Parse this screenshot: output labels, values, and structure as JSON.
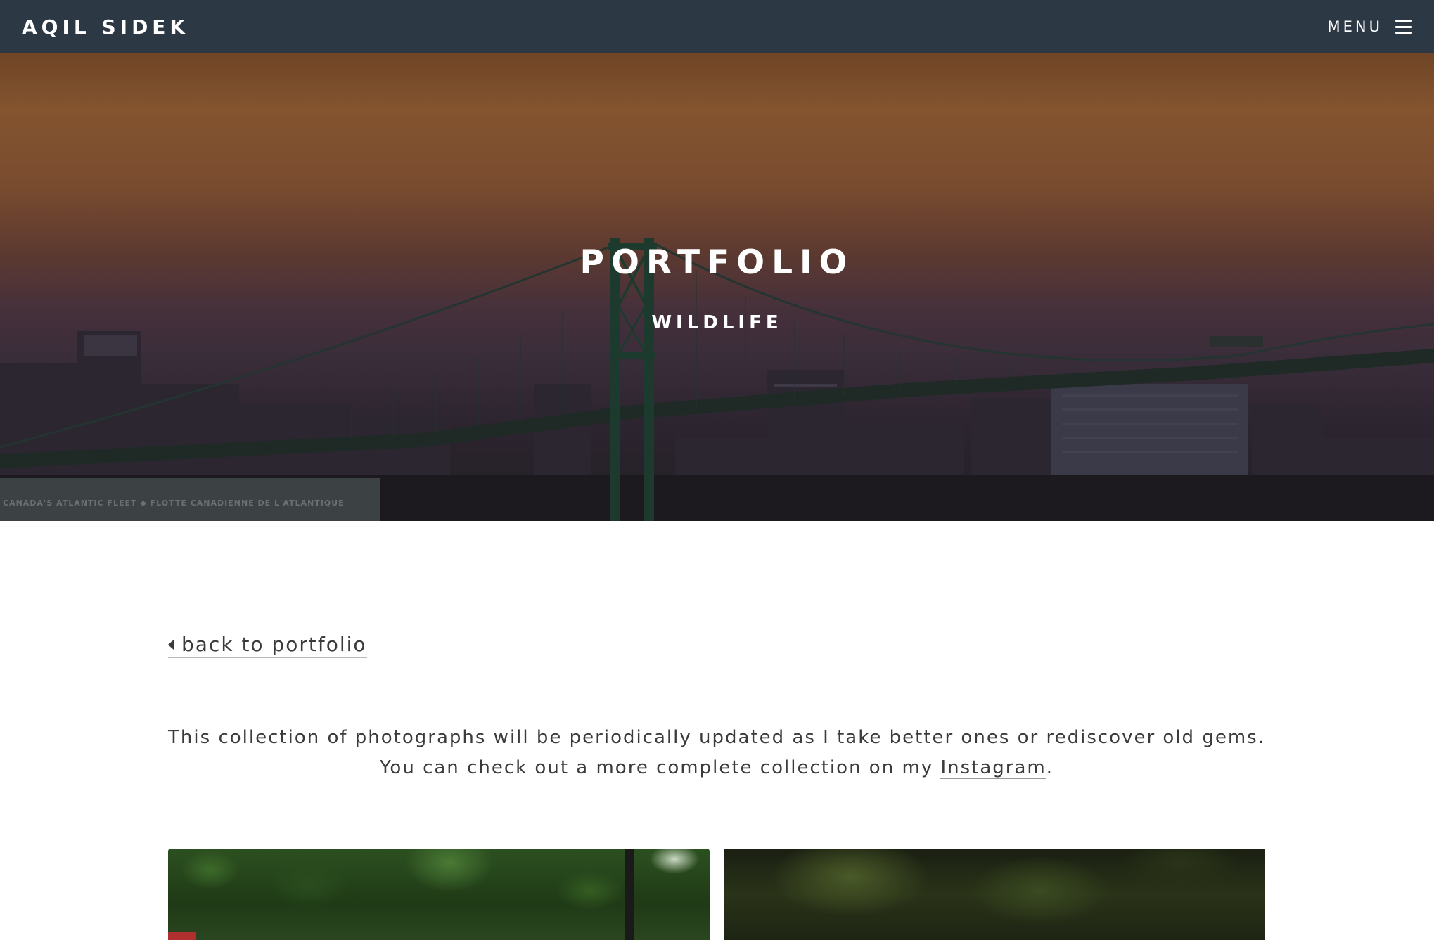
{
  "navbar": {
    "brand": "AQIL SIDEK",
    "menu_label": "MENU",
    "menu_icon": "hamburger-icon"
  },
  "hero": {
    "title": "PORTFOLIO",
    "subtitle": "WILDLIFE",
    "sign_text": "CANADA'S ATLANTIC FLEET ◆ FLOTTE CANADIENNE DE L'ATLANTIQUE"
  },
  "back_link": {
    "label": "back to portfolio",
    "icon": "caret-left-icon"
  },
  "intro": {
    "line1": "This collection of photographs will be periodically updated as I take better ones or rediscover old gems.",
    "line2_prefix": "You can check out a more complete collection on my ",
    "link_label": "Instagram",
    "line2_suffix": "."
  },
  "colors": {
    "navbar_bg": "#2d3845",
    "text": "#3b3b3b",
    "hero_text": "#ffffff"
  }
}
